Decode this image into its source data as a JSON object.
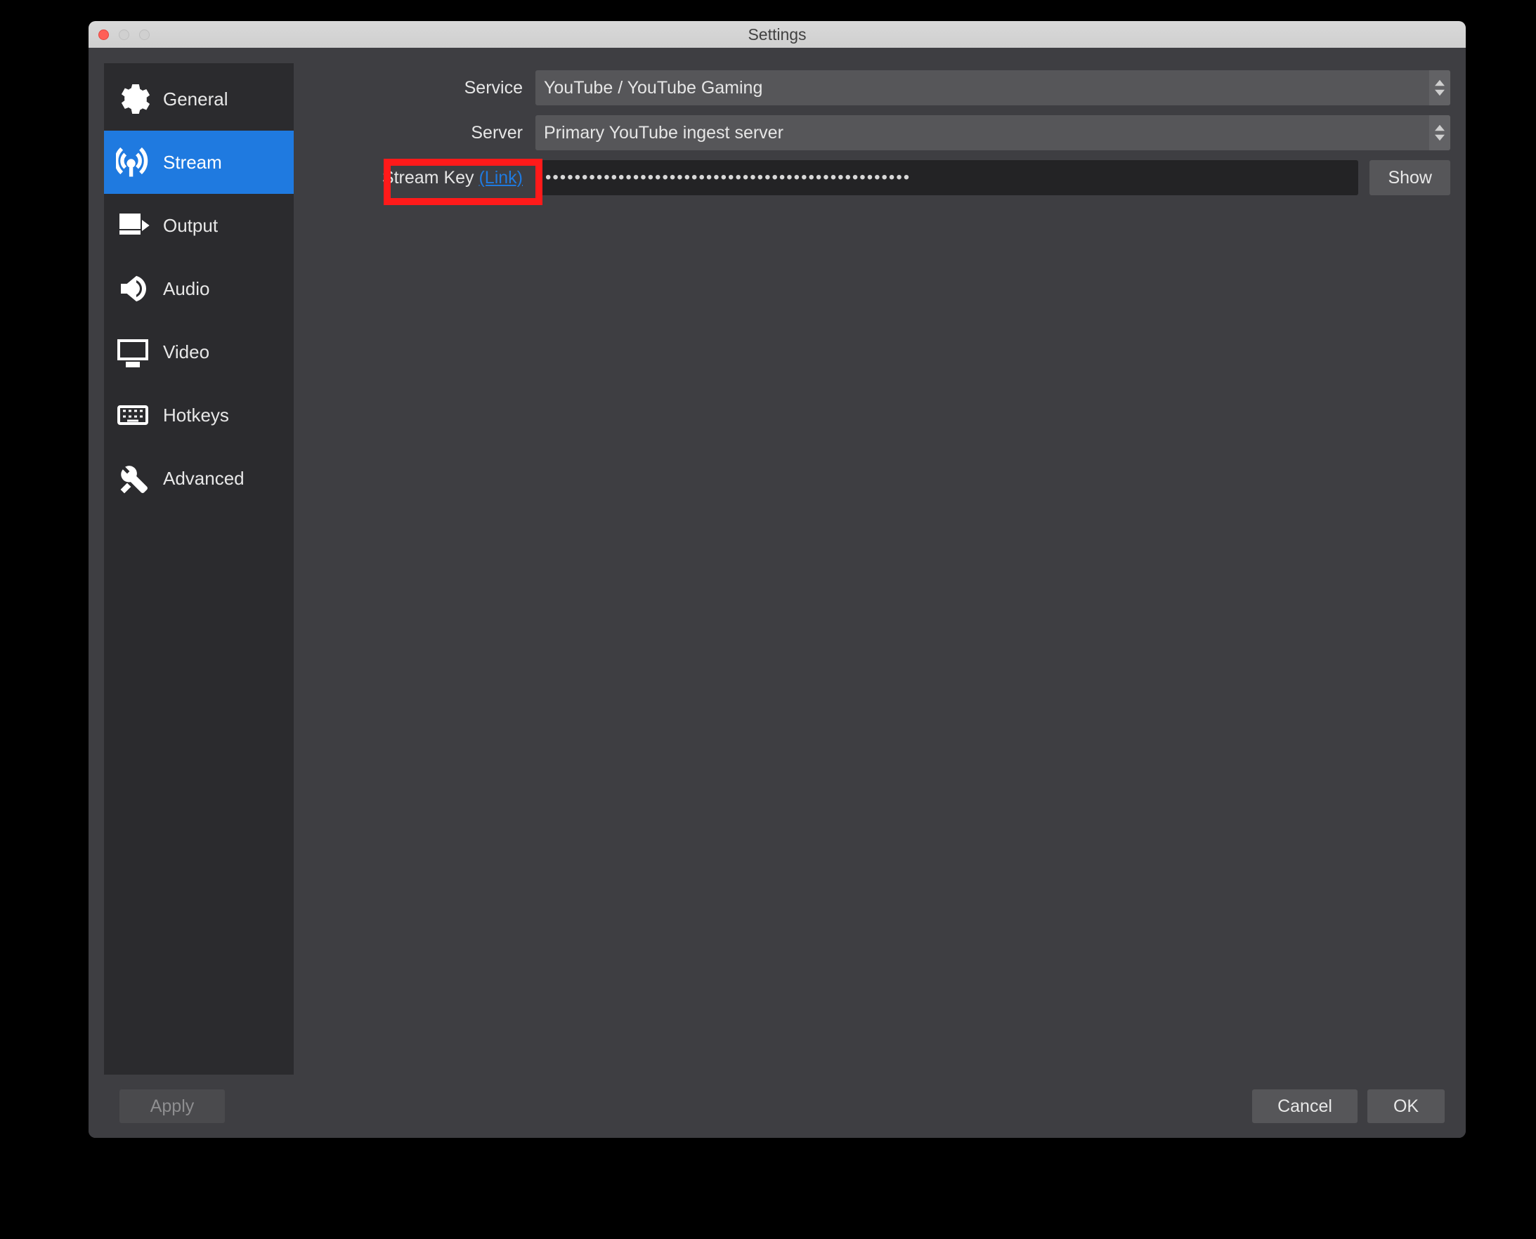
{
  "window": {
    "title": "Settings"
  },
  "sidebar": {
    "items": [
      {
        "label": "General"
      },
      {
        "label": "Stream"
      },
      {
        "label": "Output"
      },
      {
        "label": "Audio"
      },
      {
        "label": "Video"
      },
      {
        "label": "Hotkeys"
      },
      {
        "label": "Advanced"
      }
    ],
    "active_index": 1
  },
  "form": {
    "service": {
      "label": "Service",
      "value": "YouTube / YouTube Gaming"
    },
    "server": {
      "label": "Server",
      "value": "Primary YouTube ingest server"
    },
    "streamkey": {
      "label": "Stream Key",
      "link_text": "(Link)",
      "masked_value": "••••••••••••••••••••••••••••••••••••••••••••••••••",
      "show_button": "Show"
    }
  },
  "footer": {
    "apply": "Apply",
    "cancel": "Cancel",
    "ok": "OK"
  }
}
